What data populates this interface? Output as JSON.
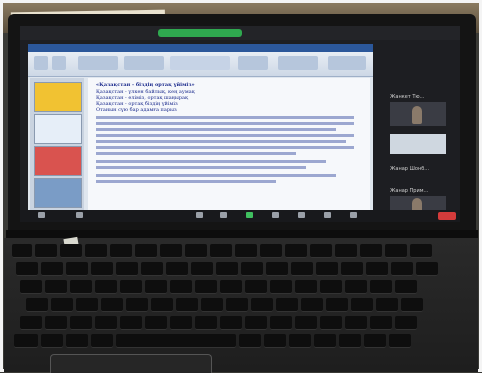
{
  "wall_note": {
    "text": ""
  },
  "zoom": {
    "top_right_items": [
      "",
      ""
    ],
    "participants": [
      {
        "name": "Жанкет Тю..."
      },
      {
        "name": ""
      },
      {
        "name": "Жанар Шонб..."
      },
      {
        "name": "Жанар Прим..."
      }
    ],
    "toolbar_labels": [
      "",
      "",
      "",
      "",
      "",
      "",
      "",
      "",
      ""
    ],
    "end_label": "End"
  },
  "ppt": {
    "window_title": "",
    "slide": {
      "title": "«Қазақстан - біздің ортақ үйіміз»",
      "lines": [
        "Қазақстан - үлкен байлық, кең аумақ",
        "Қазақстан - еліміз, ортақ шаңырақ",
        "Қазақстан - ортақ біздің үйіміз",
        "Отанын сүю бар адамға парыз"
      ]
    }
  }
}
